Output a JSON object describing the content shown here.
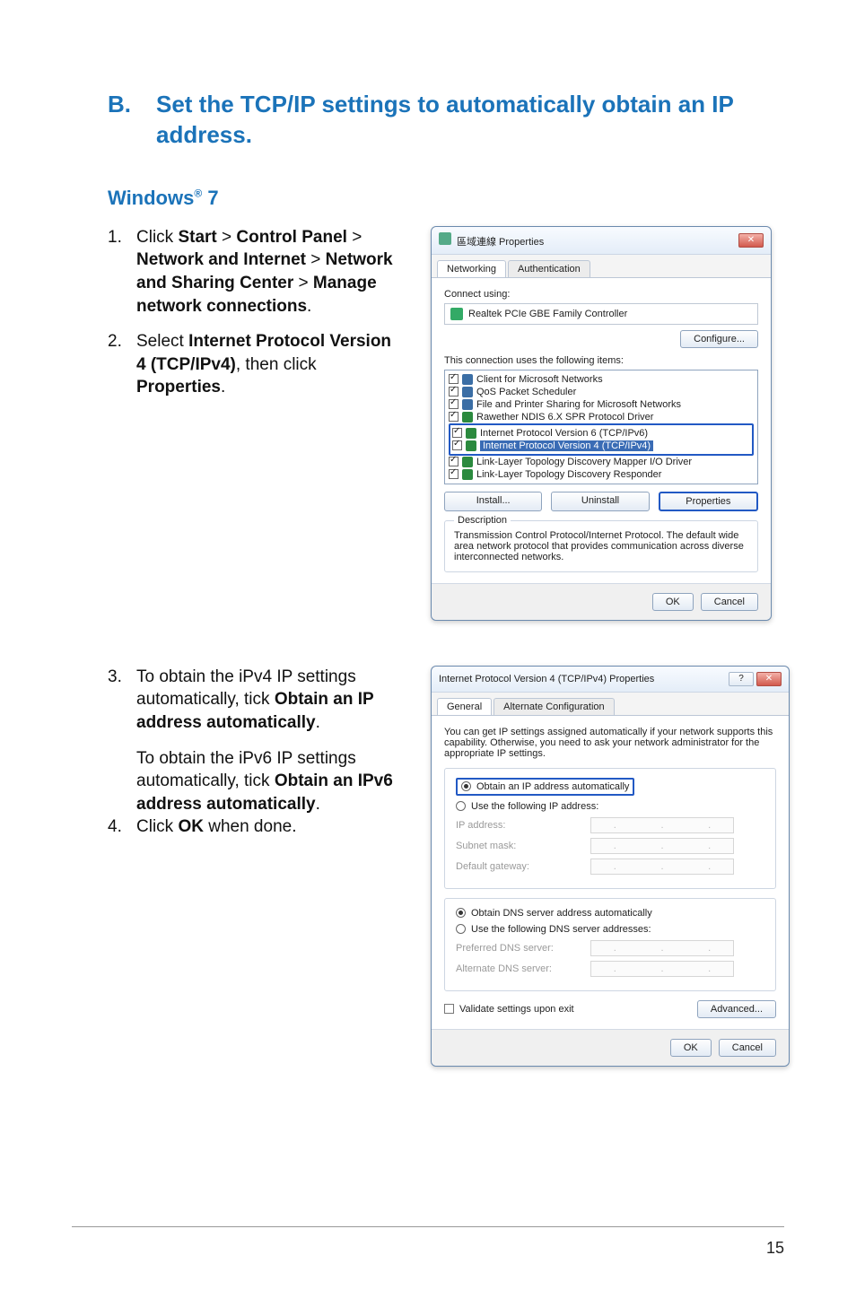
{
  "heading": {
    "letter": "B.",
    "text": "Set the TCP/IP settings to automatically obtain an IP address."
  },
  "subhead": "Windows® 7",
  "steps": {
    "s1": {
      "num": "1.",
      "parts": [
        "Click ",
        "Start",
        " > ",
        "Control Panel",
        " > ",
        "Network and Internet",
        " > ",
        "Network and Sharing Center",
        " > ",
        "Manage network connections",
        "."
      ]
    },
    "s2": {
      "num": "2.",
      "parts": [
        "Select ",
        "Internet Protocol Version 4 (TCP/IPv4)",
        ", then click ",
        "Properties",
        "."
      ]
    },
    "s3": {
      "num": "3.",
      "parts": [
        "To obtain the iPv4 IP settings automatically, tick ",
        "Obtain an IP address automatically",
        "."
      ]
    },
    "s3b": {
      "parts": [
        "To obtain the iPv6 IP settings automatically, tick ",
        "Obtain an IPv6 address automatically",
        "."
      ]
    },
    "s4": {
      "num": "4.",
      "parts": [
        "Click ",
        "OK",
        " when done."
      ]
    }
  },
  "dialog1": {
    "title": "區域連線 Properties",
    "tabs": [
      "Networking",
      "Authentication"
    ],
    "connect_using_label": "Connect using:",
    "adapter": "Realtek PCIe GBE Family Controller",
    "configure_btn": "Configure...",
    "items_label": "This connection uses the following items:",
    "items": [
      "Client for Microsoft Networks",
      "QoS Packet Scheduler",
      "File and Printer Sharing for Microsoft Networks",
      "Rawether NDIS 6.X SPR Protocol Driver",
      "Internet Protocol Version 6 (TCP/IPv6)",
      "Internet Protocol Version 4 (TCP/IPv4)",
      "Link-Layer Topology Discovery Mapper I/O Driver",
      "Link-Layer Topology Discovery Responder"
    ],
    "install_btn": "Install...",
    "uninstall_btn": "Uninstall",
    "properties_btn": "Properties",
    "desc_legend": "Description",
    "desc_text": "Transmission Control Protocol/Internet Protocol. The default wide area network protocol that provides communication across diverse interconnected networks.",
    "ok": "OK",
    "cancel": "Cancel"
  },
  "dialog2": {
    "title": "Internet Protocol Version 4 (TCP/IPv4) Properties",
    "tabs": [
      "General",
      "Alternate Configuration"
    ],
    "intro": "You can get IP settings assigned automatically if your network supports this capability. Otherwise, you need to ask your network administrator for the appropriate IP settings.",
    "r1": "Obtain an IP address automatically",
    "r2": "Use the following IP address:",
    "ip_label": "IP address:",
    "subnet_label": "Subnet mask:",
    "gateway_label": "Default gateway:",
    "r3": "Obtain DNS server address automatically",
    "r4": "Use the following DNS server addresses:",
    "pref_dns": "Preferred DNS server:",
    "alt_dns": "Alternate DNS server:",
    "validate": "Validate settings upon exit",
    "advanced": "Advanced...",
    "ok": "OK",
    "cancel": "Cancel"
  },
  "page_number": "15"
}
